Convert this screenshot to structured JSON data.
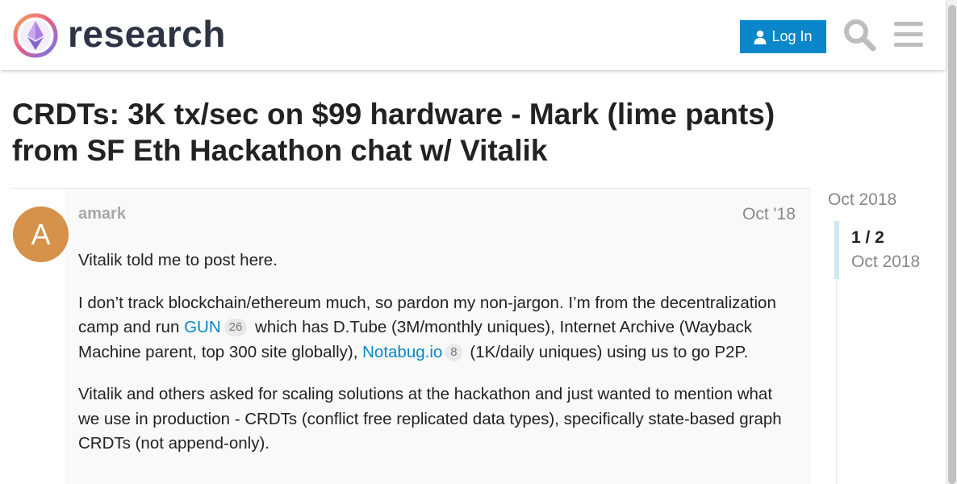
{
  "header": {
    "site_name": "research",
    "login_label": "Log In",
    "login_icon": "user-icon",
    "search_icon": "search-icon",
    "menu_icon": "hamburger-menu-icon",
    "accent_color": "#0a87ca"
  },
  "topic": {
    "title": "CRDTs: 3K tx/sec on $99 hardware - Mark (lime pants) from SF Eth Hackathon chat w/ Vitalik"
  },
  "post": {
    "avatar_letter": "A",
    "avatar_color": "#d6914a",
    "username": "amark",
    "date": "Oct '18",
    "paragraphs": {
      "p1": "Vitalik told me to post here.",
      "p2_a": "I don’t track blockchain/ethereum much, so pardon my non-jargon. I’m from the decentralization camp and run ",
      "p2_link1": "GUN",
      "p2_badge1": "26",
      "p2_b": " which has D.Tube (3M/monthly uniques), Internet Archive (Wayback Machine parent, top 300 site globally), ",
      "p2_link2": "Notabug.io",
      "p2_badge2": "8",
      "p2_c": " (1K/daily uniques) using us to go P2P.",
      "p3": "Vitalik and others asked for scaling solutions at the hackathon and just wanted to mention what we use in production - CRDTs (conflict free replicated data types), specifically state-based graph CRDTs (not append-only)."
    }
  },
  "timeline": {
    "start_date": "Oct 2018",
    "position": "1 / 2",
    "current_date": "Oct 2018"
  }
}
